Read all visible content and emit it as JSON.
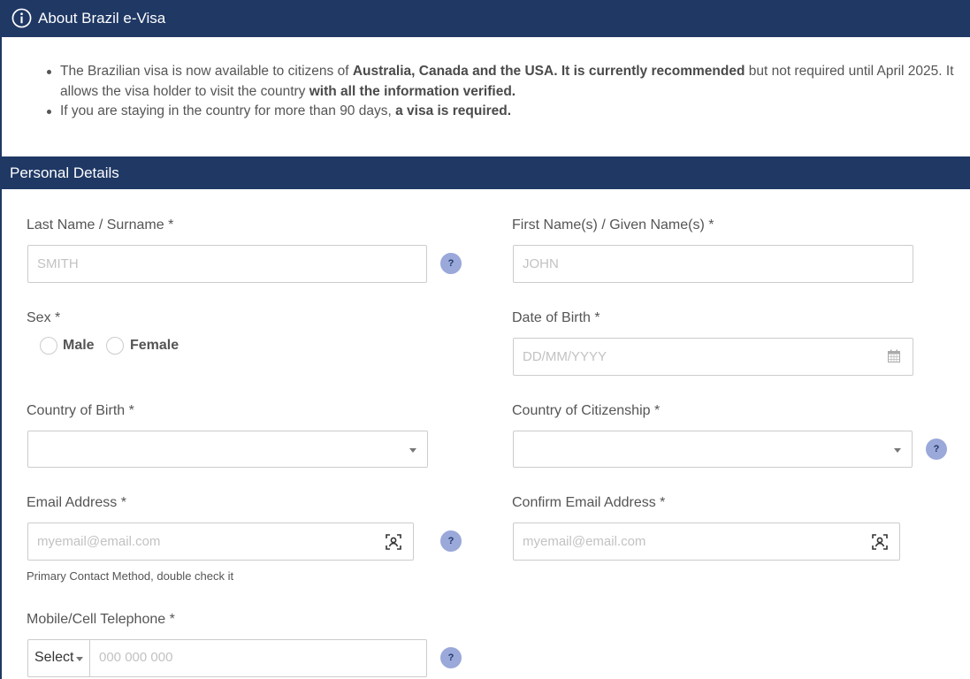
{
  "about": {
    "title": "About Brazil e-Visa",
    "bullet1": {
      "t1": "The Brazilian visa is now available to citizens of ",
      "b1": "Australia, Canada and the USA. It is currently recommended",
      "t2": " but not required until April 2025. It allows the visa holder to visit the country ",
      "b2": "with all the information verified."
    },
    "bullet2": {
      "t1": "If you are staying in the country for more than 90 days, ",
      "b1": "a visa is required."
    }
  },
  "personal": {
    "title": "Personal Details",
    "last_name": {
      "label": "Last Name / Surname *",
      "placeholder": "SMITH",
      "value": ""
    },
    "first_name": {
      "label": "First Name(s) / Given Name(s) *",
      "placeholder": "JOHN",
      "value": ""
    },
    "sex": {
      "label": "Sex *",
      "options": [
        "Male",
        "Female"
      ],
      "selected": ""
    },
    "dob": {
      "label": "Date of Birth *",
      "placeholder": "DD/MM/YYYY",
      "value": ""
    },
    "country_birth": {
      "label": "Country of Birth *",
      "value": ""
    },
    "country_citizenship": {
      "label": "Country of Citizenship *",
      "value": ""
    },
    "email": {
      "label": "Email Address *",
      "placeholder": "myemail@email.com",
      "hint": "Primary Contact Method, double check it"
    },
    "confirm_email": {
      "label": "Confirm Email Address *",
      "placeholder": "myemail@email.com"
    },
    "phone": {
      "label": "Mobile/Cell Telephone *",
      "code_label": "Select",
      "placeholder": "000 000 000"
    },
    "help_label": "?"
  },
  "colors": {
    "header_bg": "#1f3864",
    "help_bg": "#9aa8da"
  },
  "icons": [
    "info-circle-icon",
    "help-icon",
    "calendar-icon",
    "contact-scan-icon",
    "chevron-down-icon"
  ]
}
